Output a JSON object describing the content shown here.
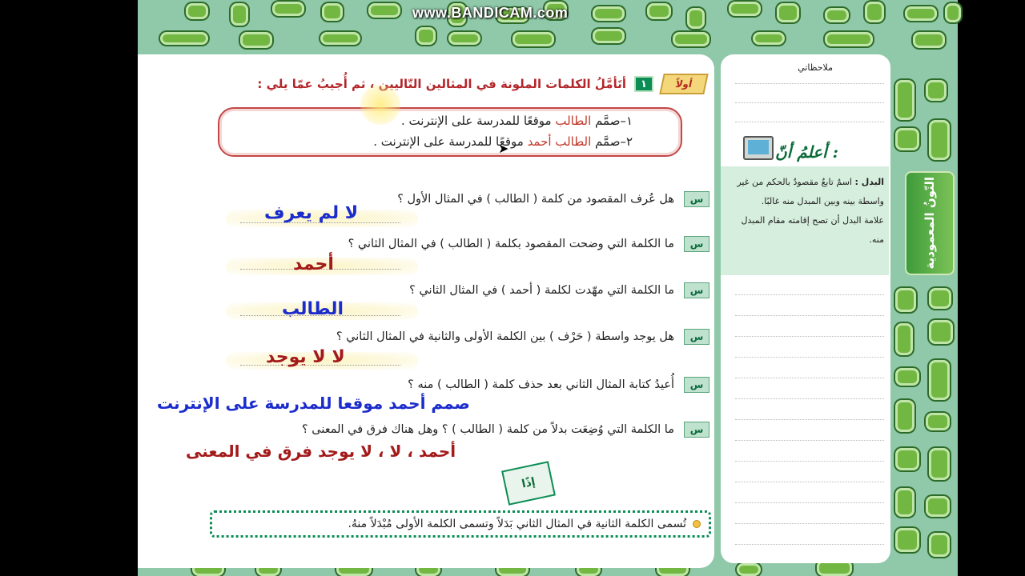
{
  "watermark": "www.BANDICAM.com",
  "lesson": {
    "section_badge": "أولاً",
    "section_number": "١",
    "instruction": "أتَأمَّلُ الكلمات الملونة في المثالين التّاليين ، ثم أُجيبُ عمّا يلي :",
    "examples": [
      {
        "prefix": "١–صمَّم ",
        "highlight": "الطالب",
        "mid": "",
        "highlight2": "",
        "rest": " موقعًا للمدرسة على الإنترنت ."
      },
      {
        "prefix": "٢–صمَّم ",
        "highlight": "الطالب",
        "mid": " ",
        "highlight2": "أحمد",
        "rest": " موقعًا للمدرسة على الإنترنت ."
      }
    ],
    "question_icon": "س",
    "questions": [
      "هل عُرف  المقصود من كلمة ( الطالب ) في المثال الأول ؟",
      "ما الكلمة التي وضحت المقصود بكلمة ( الطالب ) في المثال الثاني ؟",
      "ما الكلمة التي مهّدت لكلمة ( أحمد ) في المثال الثاني ؟",
      "هل يوجد واسطة ( حَرْف ) بين الكلمة الأولى والثانية في المثال الثاني ؟",
      "أُعيدُ كتابة المثال الثاني بعد حذف كلمة ( الطالب ) منه ؟",
      "ما الكلمة التي وُضِعَت بدلاً من كلمة ( الطالب ) ؟ وهل هناك فرق في المعنى ؟"
    ],
    "answers": [
      "لا لم يعرف",
      "أحمد",
      "الطالب",
      "لا لا يوجد",
      "صمم أحمد موقعا للمدرسة على الإنترنت",
      "أحمد ، لا ، لا يوجد فرق في المعنى"
    ],
    "conclusion_badge": "إذًا",
    "conclusion": "تُسمى الكلمة الثانية في المثال الثاني بَدَلاً وتسمى الكلمة الأولى مُبْدَلاً منهُ."
  },
  "notes": {
    "title": "ملاحظاتي",
    "know_title": "أعلمُ أنّ :",
    "know_text_1_bold": "البدل :",
    "know_text_1": " اسمٌ تابعٌ مقصودٌ بالحكم من غير واسطة بينه وبين المبدل منه غالبًا.",
    "know_text_2": "علامة البدل أن تصح إقامته مقام المبدل منه."
  },
  "side_tab": "النّونُ المعمودية",
  "colors": {
    "background": "#8fc9a9",
    "pill_green": "#73b743",
    "heading_red": "#b3262a",
    "answer_blue": "#1b2ccc",
    "answer_red": "#a31a1a",
    "rule_border": "#0b8d55"
  }
}
